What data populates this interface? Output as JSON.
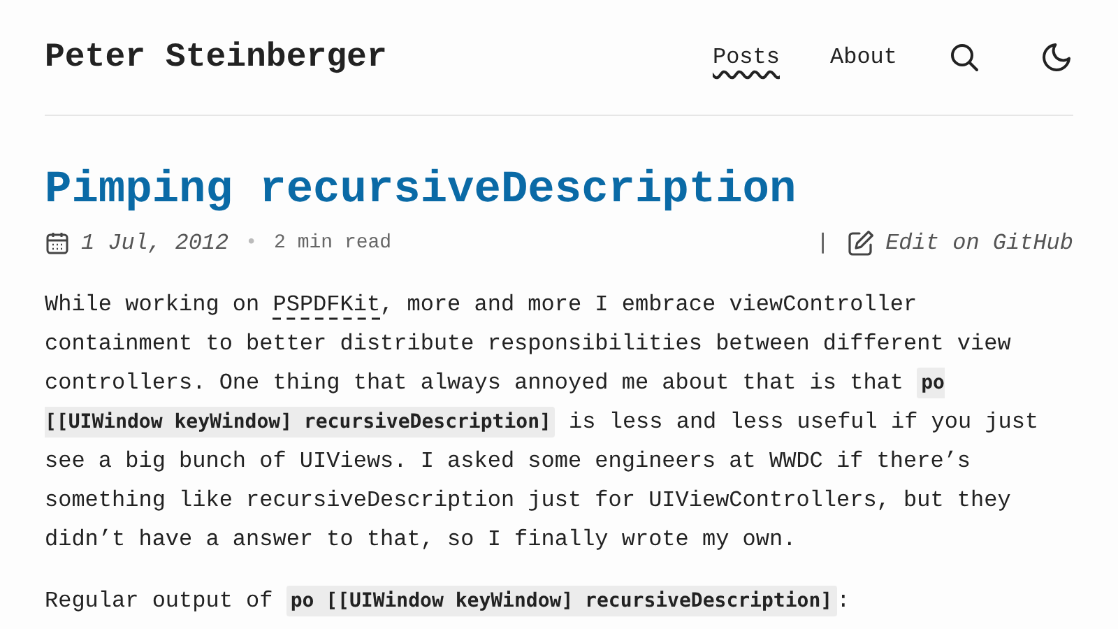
{
  "site": {
    "title": "Peter Steinberger"
  },
  "nav": [
    {
      "label": "Posts",
      "selected": true
    },
    {
      "label": "About",
      "selected": false
    }
  ],
  "post": {
    "title": "Pimping recursiveDescription",
    "date": "1 Jul, 2012",
    "separator": "•",
    "read_time": "2 min read",
    "edit_separator": "|",
    "edit_link": "Edit on GitHub",
    "paragraphs": [
      [
        {
          "kind": "text",
          "text": "While working on "
        },
        {
          "kind": "link",
          "text": "PSPDFKit"
        },
        {
          "kind": "text",
          "text": ", more and more I embrace viewController containment to better distribute responsibilities between different view controllers. One thing that always annoyed me about that is that "
        },
        {
          "kind": "code",
          "text": "po [[UIWindow keyWindow] recursiveDescription]"
        },
        {
          "kind": "text",
          "text": " is less and less useful if you just see a big bunch of UIViews. I asked some engineers at WWDC if there’s something like recursiveDescription just for UIViewControllers, but they didn’t have a answer to that, so I finally wrote my own."
        }
      ],
      [
        {
          "kind": "text",
          "text": "Regular output of "
        },
        {
          "kind": "code",
          "text": "po [[UIWindow keyWindow] recursiveDescription]"
        },
        {
          "kind": "text",
          "text": ":"
        }
      ]
    ]
  }
}
